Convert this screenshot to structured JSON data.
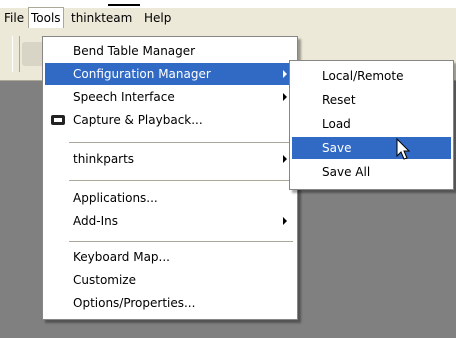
{
  "menubar": {
    "items": [
      {
        "label": "File"
      },
      {
        "label": "Tools"
      },
      {
        "label": "thinkteam"
      },
      {
        "label": "Help"
      }
    ]
  },
  "tools_menu": {
    "items": [
      {
        "label": "Bend Table Manager"
      },
      {
        "label": "Configuration Manager",
        "submenu": true,
        "highlighted": true
      },
      {
        "label": "Speech Interface",
        "submenu": true
      },
      {
        "label": "Capture & Playback...",
        "icon": "capture-icon"
      },
      {
        "label": "thinkparts",
        "submenu": true
      },
      {
        "label": "Applications..."
      },
      {
        "label": "Add-Ins",
        "submenu": true
      },
      {
        "label": "Keyboard Map..."
      },
      {
        "label": "Customize"
      },
      {
        "label": "Options/Properties..."
      }
    ]
  },
  "config_submenu": {
    "items": [
      {
        "label": "Local/Remote"
      },
      {
        "label": "Reset"
      },
      {
        "label": "Load"
      },
      {
        "label": "Save",
        "highlighted": true
      },
      {
        "label": "Save All"
      }
    ]
  },
  "colors": {
    "highlight": "#316ac5",
    "menubar": "#ece9d8",
    "workspace": "#808080"
  }
}
